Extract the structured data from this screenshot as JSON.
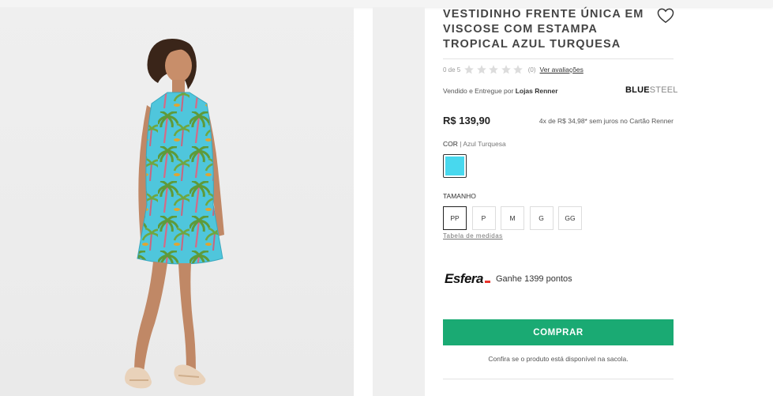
{
  "product": {
    "title": "VESTIDINHO FRENTE ÚNICA EM VISCOSE COM ESTAMPA TROPICAL AZUL TURQUESA",
    "rating_text": "0 de 5",
    "rating_value": 0,
    "rating_max": 5,
    "review_count": "(0)",
    "review_link": "Ver avaliações",
    "seller_prefix": "Vendido e Entregue por ",
    "seller_name": "Lojas Renner",
    "brand_bold": "BLUE",
    "brand_light": "STEEL",
    "price": "R$ 139,90",
    "installments": "4x de R$ 34,98* sem juros no Cartão Renner"
  },
  "color": {
    "label": "COR",
    "selected": "| Azul Turquesa",
    "swatch_hex": "#48d8ee"
  },
  "size": {
    "label": "TAMANHO",
    "options": [
      "PP",
      "P",
      "M",
      "G",
      "GG"
    ],
    "selected": "PP",
    "table_link": "Tabela de medidas"
  },
  "esfera": {
    "logo": "Esfera",
    "points_text": "Ganhe 1399 pontos"
  },
  "actions": {
    "buy_label": "COMPRAR",
    "availability_note": "Confira se o produto está disponível na sacola."
  },
  "colors": {
    "accent_green": "#1aaa73",
    "dress_turquoise": "#48d8ee"
  }
}
